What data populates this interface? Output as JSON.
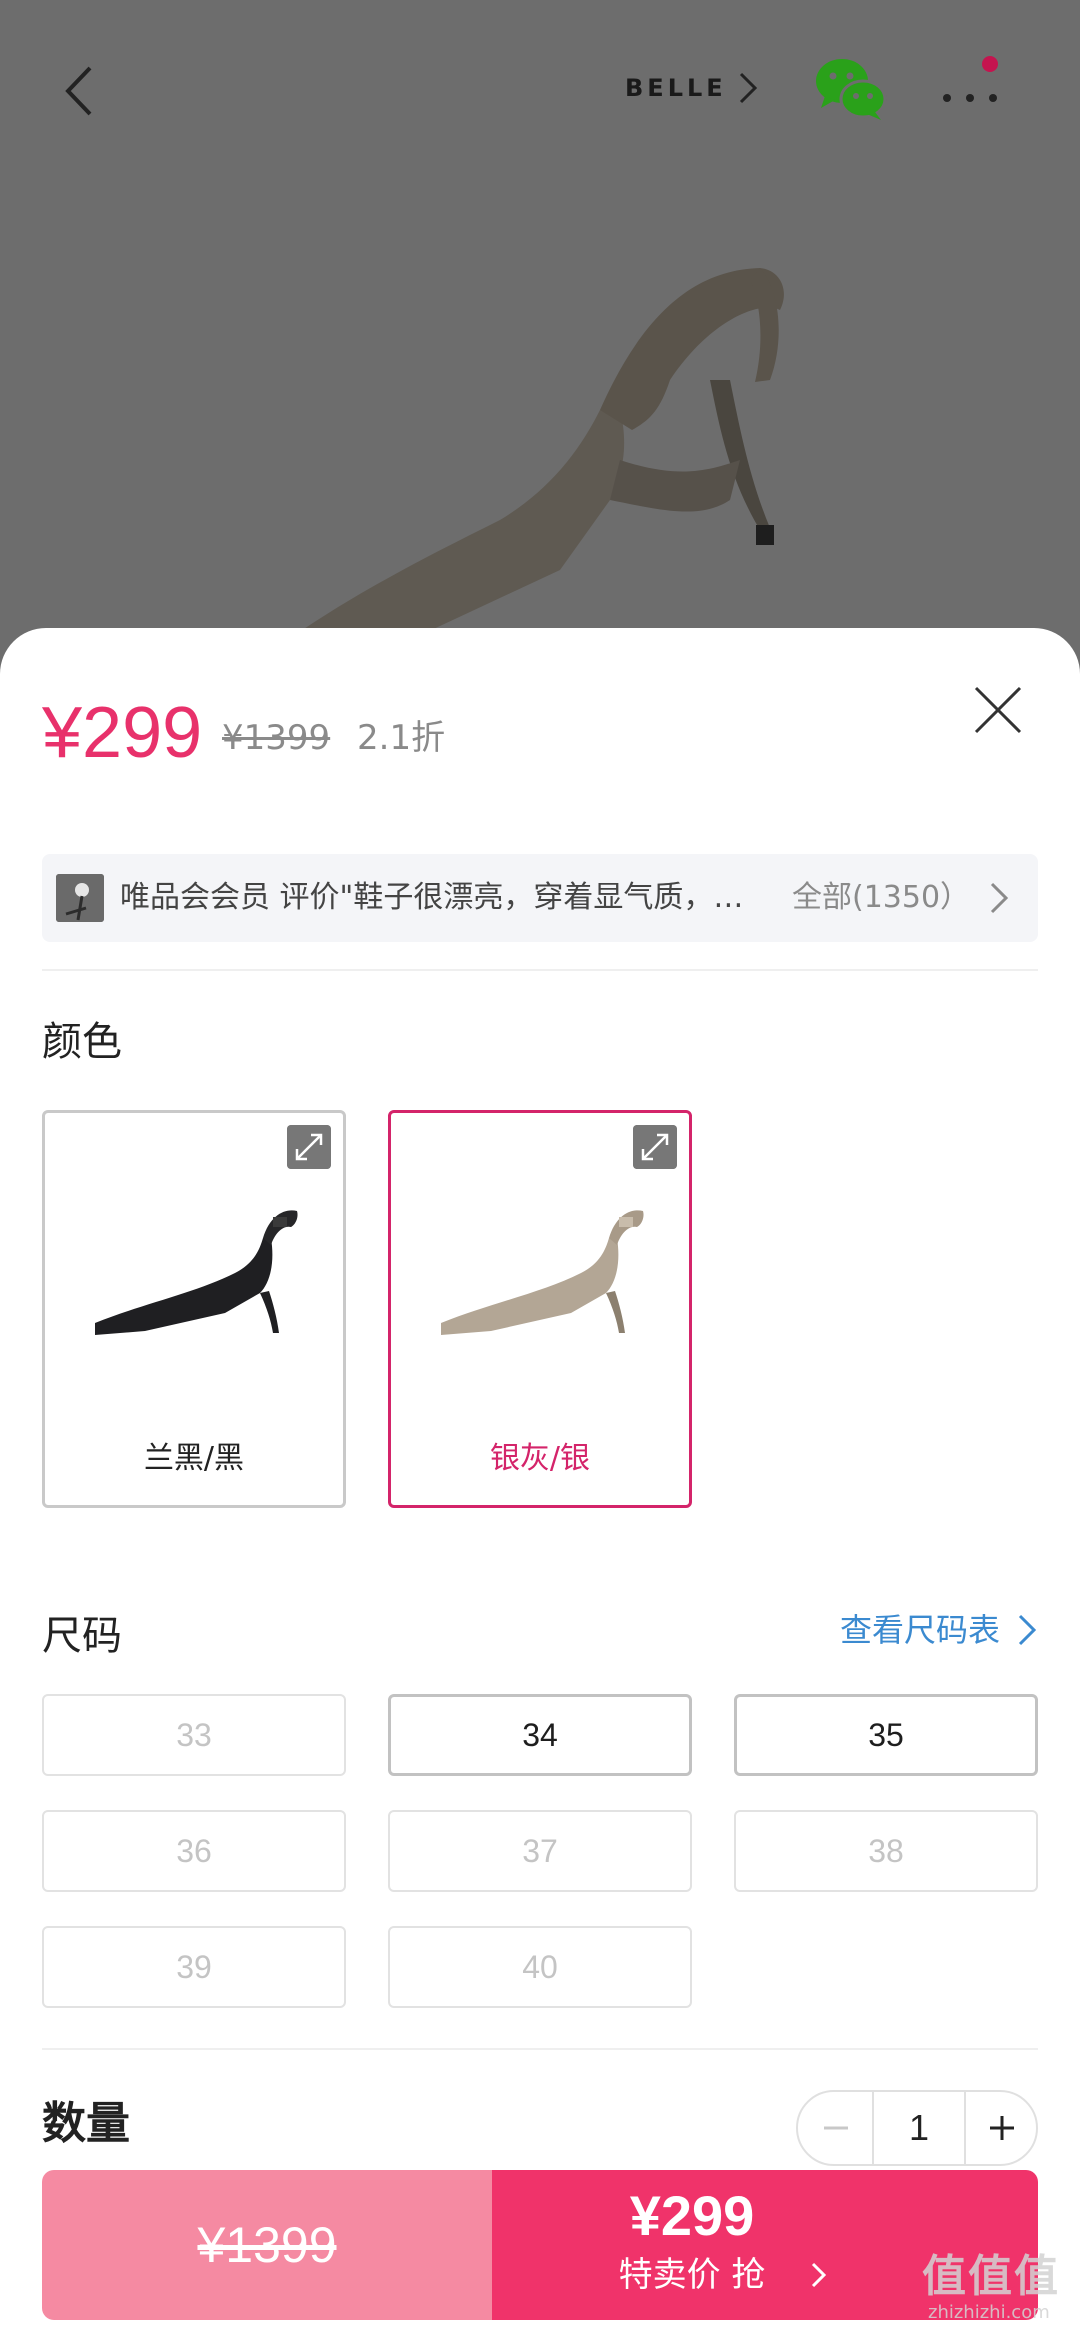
{
  "header": {
    "brand": "BELLE"
  },
  "colors": {
    "price": "#e8316b",
    "selected_border": "#d4246a",
    "link": "#3b8ad0",
    "buy_left": "#f58aa2",
    "buy_right": "#f0336a"
  },
  "price": {
    "current": "¥299",
    "original": "¥1399",
    "discount": "2.1折"
  },
  "review": {
    "text": "唯品会会员 评价\"鞋子很漂亮，穿着显气质，…",
    "all": "全部(1350）"
  },
  "color_section": {
    "title": "颜色",
    "options": [
      {
        "label": "兰黑/黑",
        "selected": false
      },
      {
        "label": "银灰/银",
        "selected": true
      }
    ]
  },
  "size_section": {
    "title": "尺码",
    "guide": "查看尺码表",
    "sizes": [
      {
        "label": "33",
        "available": false
      },
      {
        "label": "34",
        "available": true
      },
      {
        "label": "35",
        "available": true
      },
      {
        "label": "36",
        "available": false
      },
      {
        "label": "37",
        "available": false
      },
      {
        "label": "38",
        "available": false
      },
      {
        "label": "39",
        "available": false
      },
      {
        "label": "40",
        "available": false
      }
    ]
  },
  "quantity": {
    "title": "数量",
    "value": "1"
  },
  "buy_bar": {
    "original_price": "¥1399",
    "price": "¥299",
    "cta": "特卖价 抢"
  },
  "watermark": {
    "mark": "值值值",
    "url": "zhizhizhi.com"
  }
}
